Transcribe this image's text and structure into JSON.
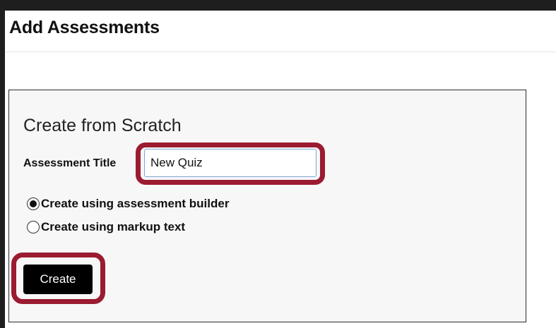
{
  "page": {
    "title": "Add Assessments"
  },
  "panel": {
    "heading": "Create from Scratch",
    "title_field": {
      "label": "Assessment Title",
      "value": "New Quiz"
    },
    "options": [
      {
        "label": "Create using assessment builder",
        "selected": true
      },
      {
        "label": "Create using markup text",
        "selected": false
      }
    ],
    "create_button_label": "Create"
  },
  "colors": {
    "highlight": "#9b1b30",
    "button_bg": "#000000",
    "panel_bg": "#f7f7f7"
  }
}
